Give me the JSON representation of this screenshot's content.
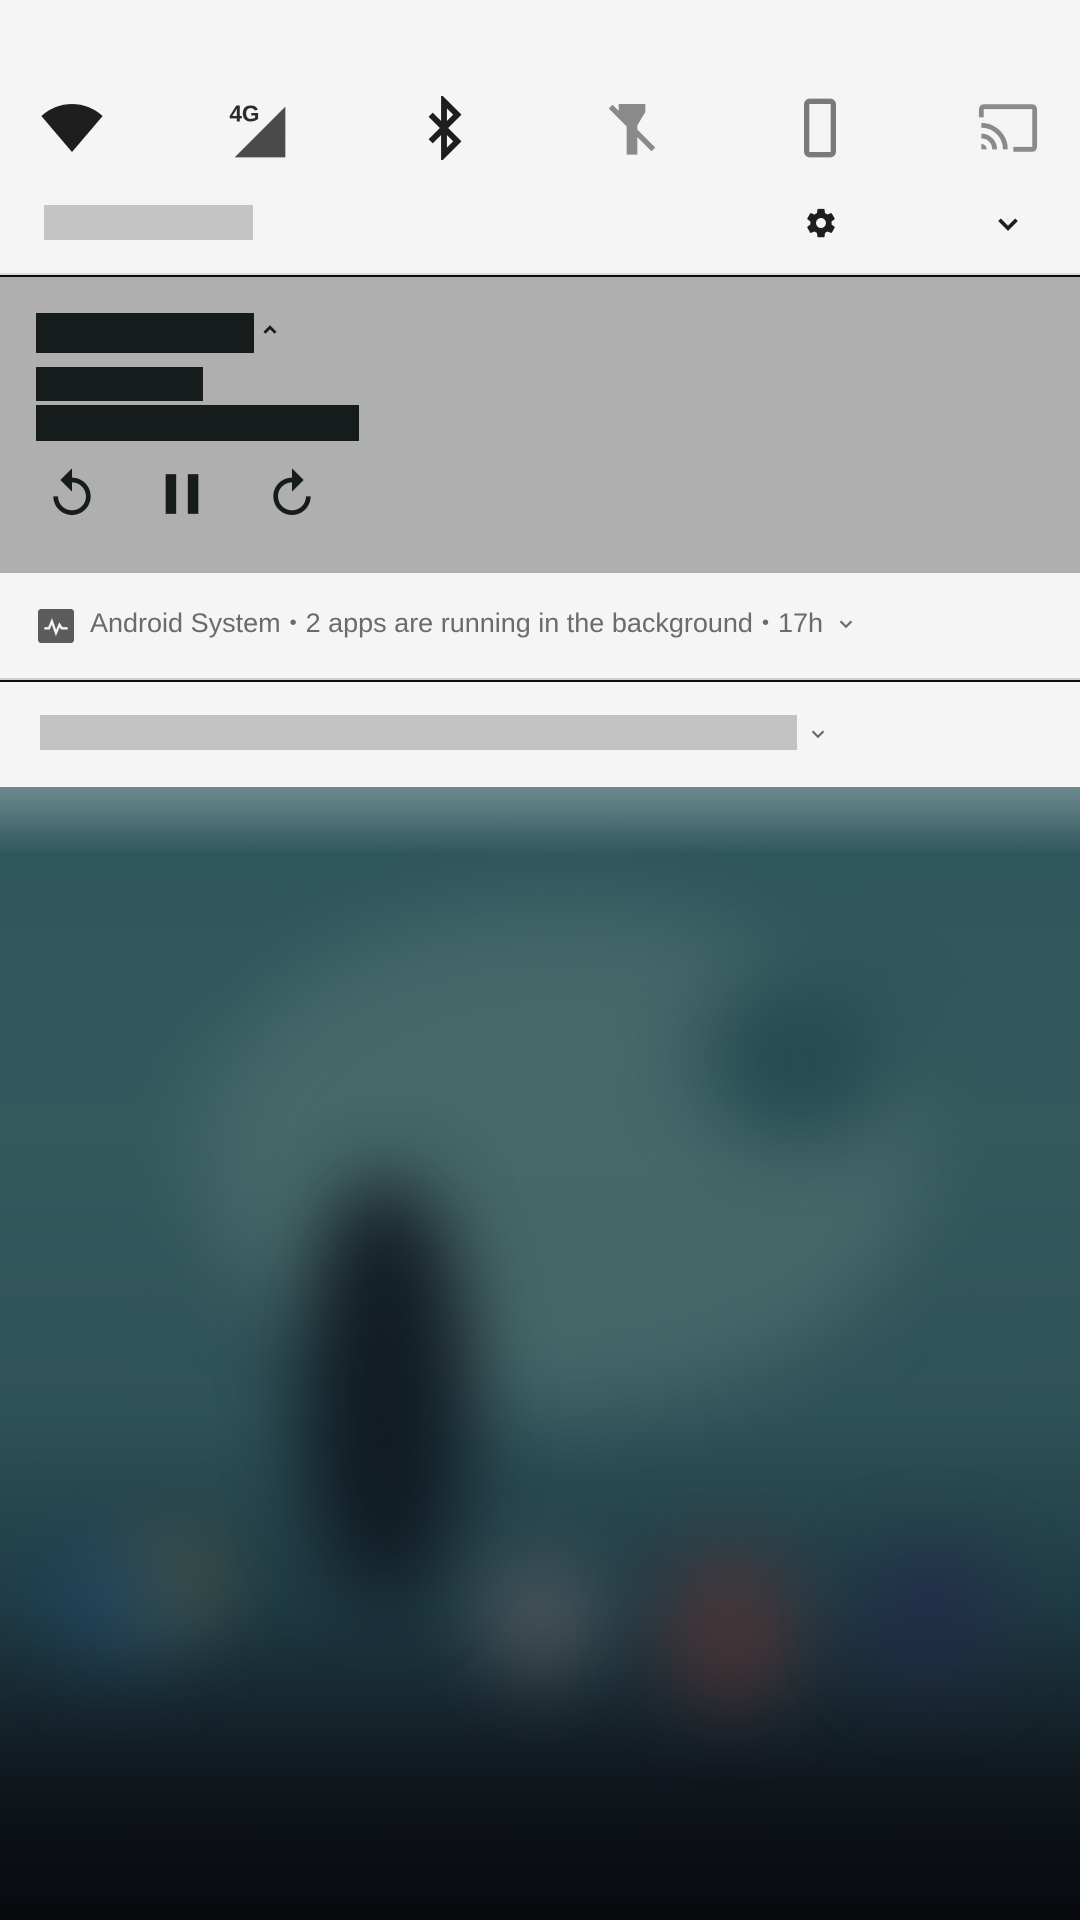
{
  "quick_settings": {
    "tiles": [
      {
        "icon": "wifi-icon"
      },
      {
        "icon": "mobile-data-4g-icon",
        "label": "4G"
      },
      {
        "icon": "bluetooth-icon"
      },
      {
        "icon": "flashlight-off-icon"
      },
      {
        "icon": "auto-rotate-portrait-icon"
      },
      {
        "icon": "cast-icon"
      }
    ],
    "settings_icon": "gear-icon",
    "expand_icon": "chevron-down-icon"
  },
  "media_notification": {
    "expand_icon": "chevron-up-icon",
    "controls": [
      "replay-back-icon",
      "pause-icon",
      "forward-icon"
    ]
  },
  "system_notification": {
    "app_name": "Android System",
    "separator": "•",
    "message": "2 apps are running in the background",
    "time": "17h"
  },
  "colors": {
    "panel_bg": "#f5f5f5",
    "media_bg": "#afafaf",
    "redaction": "#161b1b",
    "secondary_text": "#6b6b6b"
  }
}
